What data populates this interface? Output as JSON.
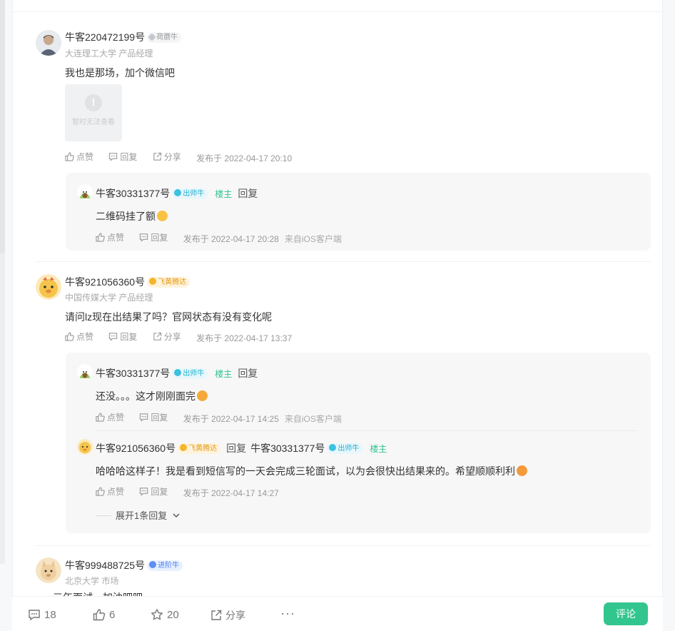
{
  "comments": [
    {
      "user": "牛客220472199号",
      "badge": "荷蘑牛",
      "school": "大连理工大学 产品经理",
      "text": "我也是那场，加个微信吧",
      "image_caption": "暂时无法查看",
      "like": "点赞",
      "reply": "回复",
      "share": "分享",
      "time": "发布于 2022-04-17 20:10",
      "replies": [
        {
          "user": "牛客30331377号",
          "badge": "出师牛",
          "owner": "楼主",
          "reply_btn": "回复",
          "text": "二维码挂了额",
          "like": "点赞",
          "reply": "回复",
          "time": "发布于 2022-04-17 20:28",
          "source": "来自iOS客户端"
        }
      ]
    },
    {
      "user": "牛客921056360号",
      "badge": "飞黄腾达",
      "school": "中国传媒大学 产品经理",
      "text": "请问lz现在出结果了吗？官网状态有没有变化呢",
      "like": "点赞",
      "reply": "回复",
      "share": "分享",
      "time": "发布于 2022-04-17 13:37",
      "replies": [
        {
          "user": "牛客30331377号",
          "badge": "出师牛",
          "owner": "楼主",
          "reply_btn": "回复",
          "text": "还没。。。这才刚刚面完",
          "like": "点赞",
          "reply": "回复",
          "time": "发布于 2022-04-17 14:25",
          "source": "来自iOS客户端"
        },
        {
          "user": "牛客921056360号",
          "badge": "飞黄腾达",
          "reply_word": "回复",
          "target_user": "牛客30331377号",
          "target_badge": "出师牛",
          "target_owner": "楼主",
          "text": "哈哈哈这样子！我是看到短信写的一天会完成三轮面试，以为会很快出结果来的。希望顺顺利利",
          "like": "点赞",
          "reply": "回复",
          "time": "发布于 2022-04-17 14:27"
        }
      ],
      "expand": "展开1条回复"
    },
    {
      "user": "牛客999488725号",
      "badge": "进阶牛",
      "school": "北京大学 市场",
      "text_partial": "三年面试，加油吧吧"
    }
  ],
  "bottom_bar": {
    "comments": "18",
    "likes": "6",
    "stars": "20",
    "share": "分享",
    "more": "···",
    "comment_btn": "评论"
  },
  "colors": {
    "accent": "#32c68e",
    "owner_tag": "#30c48d",
    "badge_cyan": "#1fb0d2",
    "badge_gold": "#e59a13",
    "badge_blue": "#4a7ff0"
  }
}
